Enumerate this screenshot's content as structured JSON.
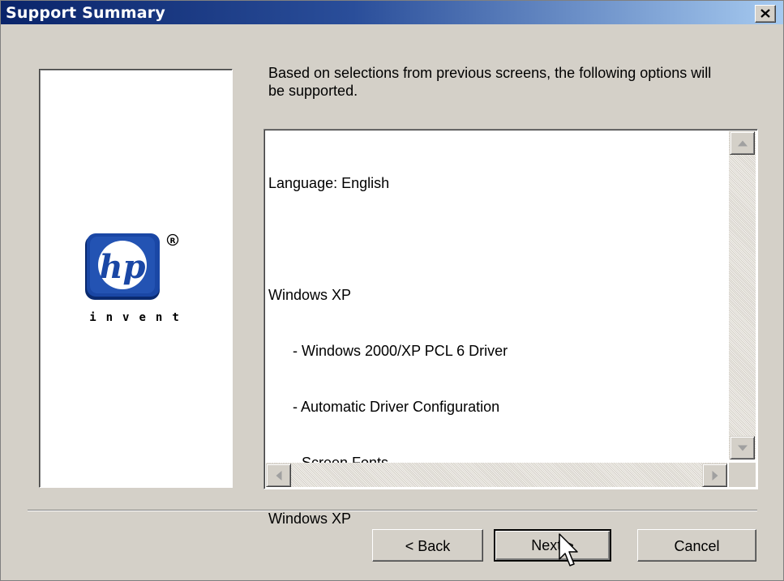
{
  "window": {
    "title": "Support Summary",
    "close_glyph": "close-icon"
  },
  "logo": {
    "brand": "hp",
    "registered": "®",
    "tagline": "invent",
    "brand_color": "#1a47a5"
  },
  "intro_text": "Based on selections from previous screens, the following options will be supported.",
  "summary_list": {
    "lines": [
      "Language: English",
      "",
      "Windows XP",
      "- Windows 2000/XP PCL 6 Driver",
      "- Automatic Driver Configuration",
      "- Screen Fonts",
      "Windows XP"
    ]
  },
  "buttons": {
    "back": "< Back",
    "next": "Next >",
    "cancel": "Cancel"
  },
  "colors": {
    "title_gradient_start": "#0a246a",
    "title_gradient_end": "#a6caf0",
    "dialog_face": "#d4d0c8"
  }
}
